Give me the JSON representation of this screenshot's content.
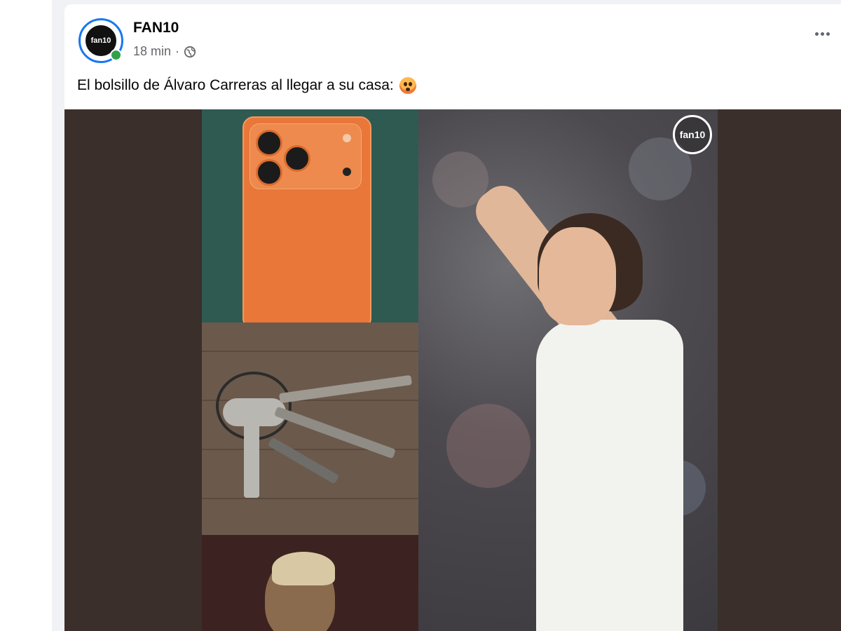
{
  "post": {
    "author": "FAN10",
    "avatar_text": "fan10",
    "time": "18 min",
    "separator": "·",
    "caption": "El bolsillo de Álvaro Carreras al llegar a su casa:",
    "watermark_text": "fan10"
  },
  "icons": {
    "privacy": "globe-icon",
    "more": "more-options-icon",
    "reaction": "hot-face-emoji",
    "presence": "online-dot"
  },
  "colors": {
    "online": "#31a24c",
    "avatar_ring": "#1877f2",
    "media_bg": "#3a2f2b"
  }
}
